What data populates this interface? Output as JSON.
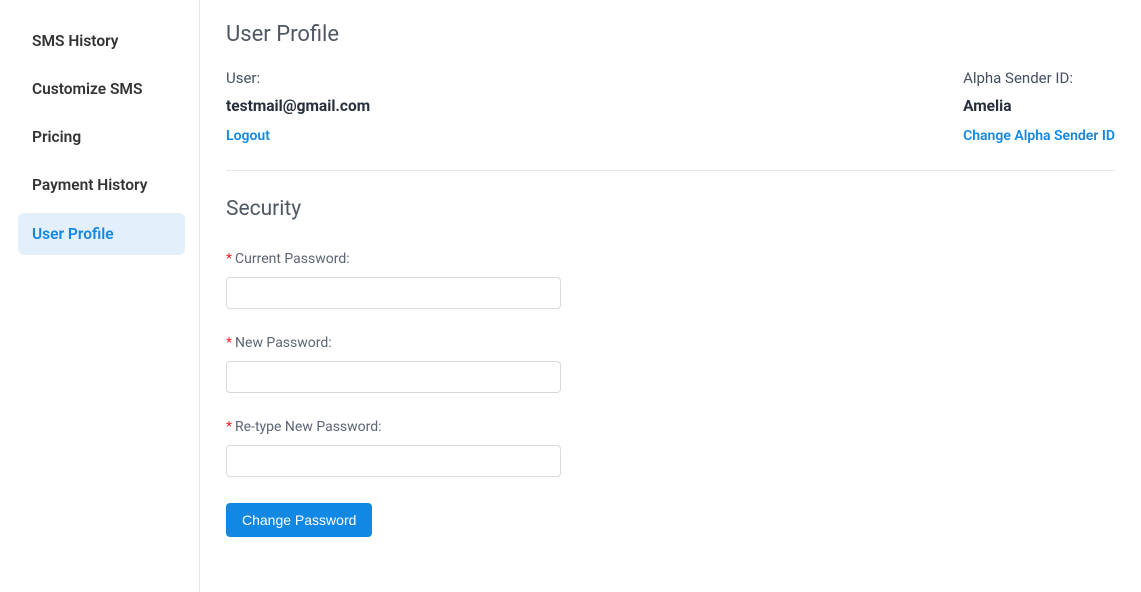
{
  "sidebar": {
    "items": [
      {
        "label": "SMS History",
        "active": false
      },
      {
        "label": "Customize SMS",
        "active": false
      },
      {
        "label": "Pricing",
        "active": false
      },
      {
        "label": "Payment History",
        "active": false
      },
      {
        "label": "User Profile",
        "active": true
      }
    ]
  },
  "profile": {
    "title": "User Profile",
    "user_label": "User:",
    "user_value": "testmail@gmail.com",
    "logout_label": "Logout",
    "alpha_label": "Alpha Sender ID:",
    "alpha_value": "Amelia",
    "change_alpha_label": "Change Alpha Sender ID"
  },
  "security": {
    "title": "Security",
    "current_password_label": "Current Password:",
    "current_password_value": "",
    "new_password_label": "New Password:",
    "new_password_value": "",
    "retype_password_label": "Re-type New Password:",
    "retype_password_value": "",
    "change_password_button": "Change Password"
  }
}
